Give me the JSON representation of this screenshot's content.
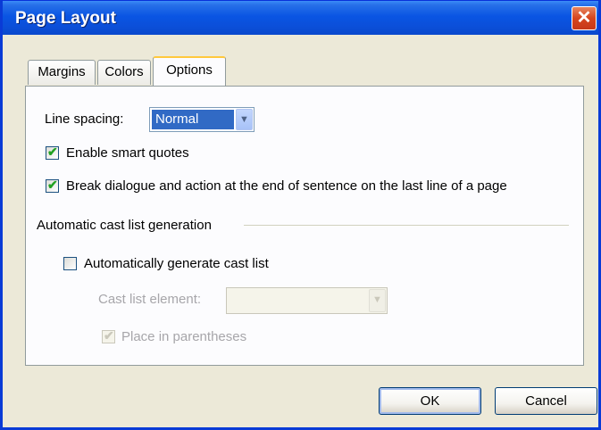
{
  "window": {
    "title": "Page Layout",
    "close_symbol": "✕"
  },
  "tabs": [
    {
      "label": "Margins",
      "selected": false
    },
    {
      "label": "Colors",
      "selected": false
    },
    {
      "label": "Options",
      "selected": true
    }
  ],
  "options": {
    "line_spacing_label": "Line spacing:",
    "line_spacing_value": "Normal",
    "smart_quotes_label": "Enable smart quotes",
    "smart_quotes_checked": true,
    "break_dialogue_label": "Break dialogue and action at the end of sentence on the last line of a page",
    "break_dialogue_checked": true
  },
  "cast_list": {
    "group_label": "Automatic cast list generation",
    "auto_generate_label": "Automatically generate cast list",
    "auto_generate_checked": false,
    "element_label": "Cast list element:",
    "element_value": "",
    "parentheses_label": "Place in parentheses",
    "parentheses_checked": true
  },
  "buttons": {
    "ok": "OK",
    "cancel": "Cancel"
  },
  "icons": {
    "checkmark": "✔",
    "dropdown_arrow": "▼"
  }
}
